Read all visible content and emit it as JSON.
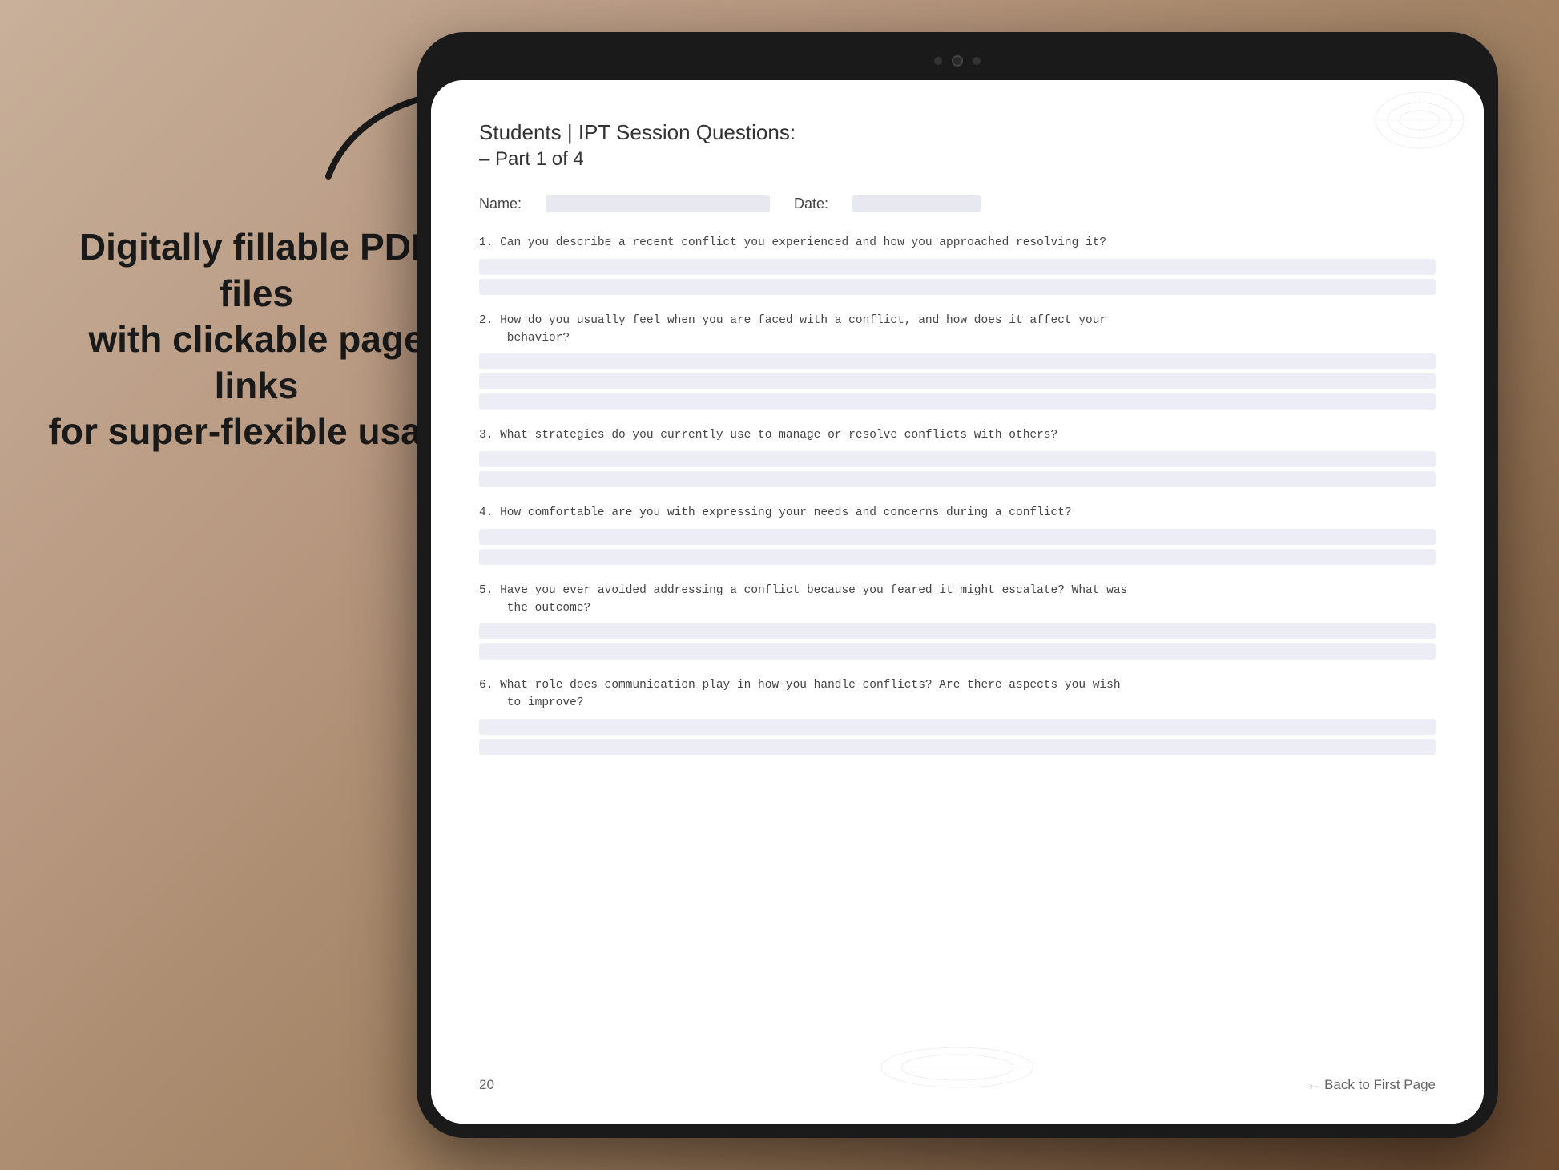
{
  "background": {
    "color_start": "#c8b09a",
    "color_end": "#6b4a30"
  },
  "left_text": {
    "line1": "Digitally fillable PDF files",
    "line2": "with clickable page links",
    "line3": "for super-flexible usage"
  },
  "tablet": {
    "screen": {
      "pdf": {
        "title": "Students | IPT Session Questions:",
        "subtitle": "– Part 1 of 4",
        "fields": {
          "name_label": "Name:",
          "date_label": "Date:"
        },
        "questions": [
          {
            "number": "1.",
            "text": "Can you describe a recent conflict you experienced and how you approached resolving it?",
            "answer_lines": 2
          },
          {
            "number": "2.",
            "text": "How do you usually feel when you are faced with a conflict, and how does it affect your\nbehavior?",
            "answer_lines": 3
          },
          {
            "number": "3.",
            "text": "What strategies do you currently use to manage or resolve conflicts with others?",
            "answer_lines": 2
          },
          {
            "number": "4.",
            "text": "How comfortable are you with expressing your needs and concerns during a conflict?",
            "answer_lines": 2
          },
          {
            "number": "5.",
            "text": "Have you ever avoided addressing a conflict because you feared it might escalate? What was\nthe outcome?",
            "answer_lines": 2
          },
          {
            "number": "6.",
            "text": "What role does communication play in how you handle conflicts? Are there aspects you wish\nto improve?",
            "answer_lines": 2
          }
        ],
        "footer": {
          "page_number": "20",
          "back_link": "← Back to First Page"
        }
      }
    }
  }
}
